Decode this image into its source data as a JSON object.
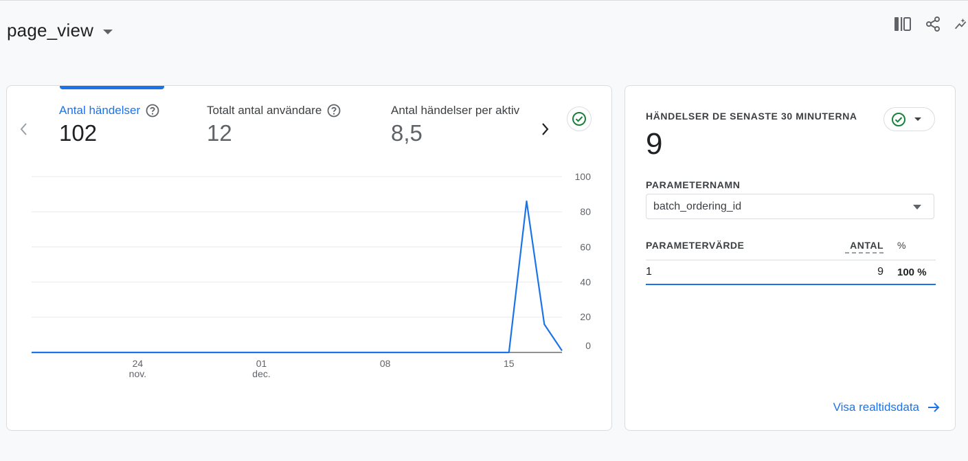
{
  "header": {
    "title": "page_view",
    "actions": [
      "compare-icon",
      "share-icon",
      "insights-icon"
    ]
  },
  "metrics_card": {
    "metrics": [
      {
        "label": "Antal händelser",
        "value": "102",
        "active": true
      },
      {
        "label": "Totalt antal användare",
        "value": "12",
        "active": false
      },
      {
        "label": "Antal händelser per aktiv",
        "value": "8,5",
        "active": false
      }
    ],
    "status_icon": "check-circle-icon",
    "colors": {
      "accent": "#1a73e8",
      "status": "#188038"
    }
  },
  "chart_data": {
    "type": "line",
    "x_ticks": [
      {
        "day": "24",
        "month": "nov."
      },
      {
        "day": "01",
        "month": "dec."
      },
      {
        "day": "08",
        "month": ""
      },
      {
        "day": "15",
        "month": ""
      }
    ],
    "y_ticks": [
      "100",
      "80",
      "60",
      "40",
      "20",
      "0"
    ],
    "ylim": [
      0,
      100
    ],
    "grid": true,
    "series": [
      {
        "color": "#1a73e8",
        "x": [
          "2023-11-18",
          "2023-11-19",
          "2023-11-20",
          "2023-11-21",
          "2023-11-22",
          "2023-11-23",
          "2023-11-24",
          "2023-11-25",
          "2023-11-26",
          "2023-11-27",
          "2023-11-28",
          "2023-11-29",
          "2023-11-30",
          "2023-12-01",
          "2023-12-02",
          "2023-12-03",
          "2023-12-04",
          "2023-12-05",
          "2023-12-06",
          "2023-12-07",
          "2023-12-08",
          "2023-12-09",
          "2023-12-10",
          "2023-12-11",
          "2023-12-12",
          "2023-12-13",
          "2023-12-14",
          "2023-12-15",
          "2023-12-16",
          "2023-12-17",
          "2023-12-18"
        ],
        "values": [
          0,
          0,
          0,
          0,
          0,
          0,
          0,
          0,
          0,
          0,
          0,
          0,
          0,
          0,
          0,
          0,
          0,
          0,
          0,
          0,
          0,
          0,
          0,
          0,
          0,
          0,
          0,
          0,
          86,
          16,
          1
        ]
      }
    ]
  },
  "side_card": {
    "title": "HÄNDELSER DE SENASTE 30 MINUTERNA",
    "value": "9",
    "status_icon": "check-circle-icon",
    "param_label": "PARAMETERNAMN",
    "param_selected": "batch_ordering_id",
    "table": {
      "headers": {
        "name": "PARAMETERVÄRDE",
        "count": "ANTAL",
        "pct": "%"
      },
      "rows": [
        {
          "name": "1",
          "count": "9",
          "pct": "100 %"
        }
      ]
    },
    "link_label": "Visa realtidsdata"
  }
}
